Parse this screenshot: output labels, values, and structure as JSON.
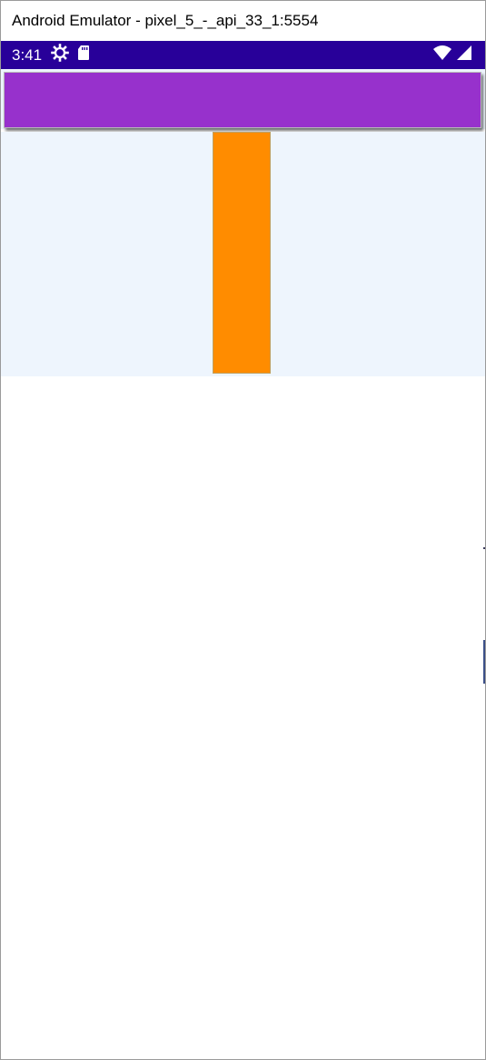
{
  "window": {
    "title": "Android Emulator - pixel_5_-_api_33_1:5554"
  },
  "status_bar": {
    "time": "3:41",
    "background": "#280099",
    "icons": [
      "settings-gear-icon",
      "sd-card-icon",
      "wifi-icon",
      "cellular-signal-icon"
    ]
  },
  "app": {
    "header_color": "#9731cc",
    "content_background": "#eef5fd",
    "box_color": "#ff8c00"
  }
}
